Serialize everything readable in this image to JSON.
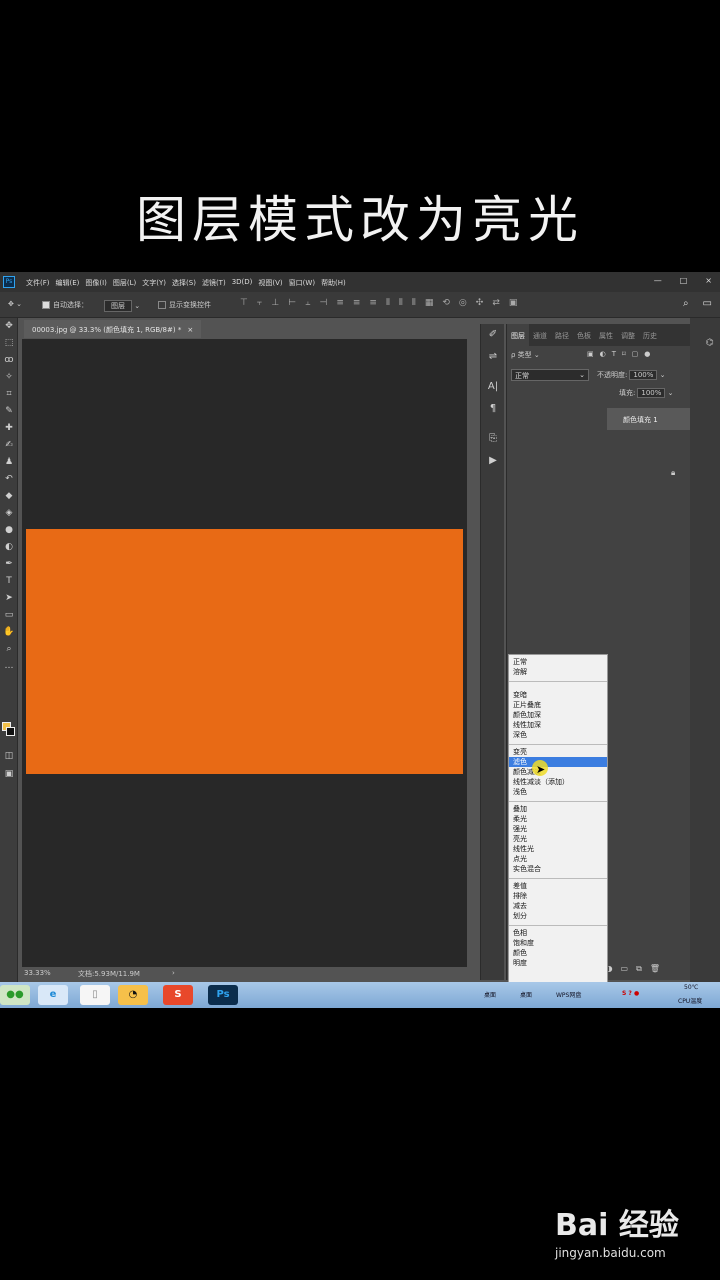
{
  "caption": "图层模式改为亮光",
  "app": {
    "logo": "Ps",
    "menus": [
      "文件(F)",
      "编辑(E)",
      "图像(I)",
      "图层(L)",
      "文字(Y)",
      "选择(S)",
      "滤镜(T)",
      "3D(D)",
      "视图(V)",
      "窗口(W)",
      "帮助(H)"
    ],
    "window_controls": [
      "—",
      "□",
      "×"
    ]
  },
  "options_bar": {
    "auto_select_label": "自动选择：",
    "auto_select_value": "图层",
    "show_transform_label": "显示变换控件"
  },
  "document": {
    "tab_title": "00003.jpg @ 33.3% (颜色填充 1, RGB/8#) *",
    "fill_color": "#e86a15",
    "zoom": "33.33%",
    "doc_size": "文档:5.93M/11.9M"
  },
  "layers_panel": {
    "tabs": [
      "图层",
      "通道",
      "路径",
      "色板",
      "属性",
      "调整",
      "历史"
    ],
    "filter_label": "类型",
    "blend_mode": "正常",
    "opacity_label": "不透明度:",
    "opacity_value": "100%",
    "fill_label": "填充:",
    "fill_value": "100%",
    "layer_name": "颜色填充 1"
  },
  "blend_dropdown": {
    "groups": [
      [
        "正常",
        "溶解"
      ],
      [
        "变暗",
        "正片叠底",
        "颜色加深",
        "线性加深",
        "深色"
      ],
      [
        "变亮",
        "滤色",
        "颜色减淡",
        "线性减淡（添加）",
        "浅色"
      ],
      [
        "叠加",
        "柔光",
        "强光",
        "亮光",
        "线性光",
        "点光",
        "实色混合"
      ],
      [
        "差值",
        "排除",
        "减去",
        "划分"
      ],
      [
        "色相",
        "饱和度",
        "颜色",
        "明度"
      ]
    ],
    "highlighted": "滤色"
  },
  "taskbar": {
    "apps": [
      "wechat",
      "ie",
      "file",
      "qq",
      "sogou",
      "photoshop"
    ],
    "ps_label": "Ps",
    "sogou_label": "S",
    "tray_items": [
      "桌面",
      "桌面",
      "WPS网盘"
    ],
    "temp": "50℃",
    "cpu_label": "CPU温度"
  },
  "watermark": {
    "brand": "Bai 经验",
    "url": "jingyan.baidu.com"
  }
}
